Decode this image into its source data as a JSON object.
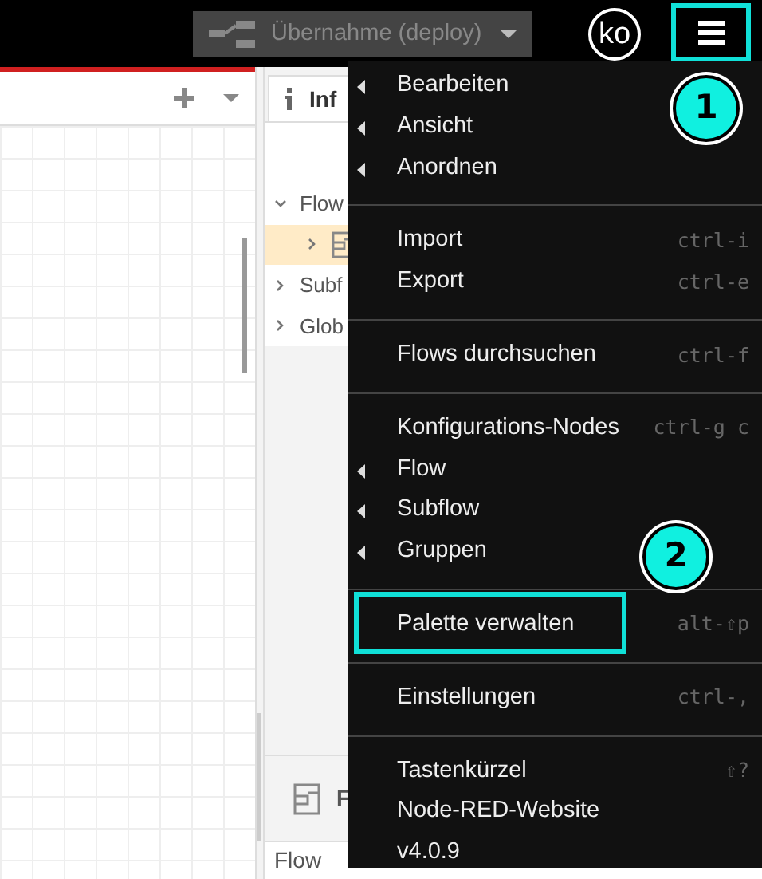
{
  "header": {
    "deploy": {
      "label": "Übernahme (deploy)",
      "disabled": true
    },
    "user": {
      "initials": "ko"
    },
    "menu_button": {
      "highlighted": true
    }
  },
  "sidebar": {
    "tab": {
      "label": "Inf",
      "selected": true
    },
    "tree": [
      {
        "label": "Flow",
        "expanded": true,
        "selected": false,
        "children": [
          {
            "selected": true,
            "expanded": false
          }
        ]
      },
      {
        "label": "Subf",
        "expanded": false,
        "selected": false
      },
      {
        "label": "Glob",
        "expanded": false,
        "selected": false
      }
    ],
    "bottom_panel": {
      "title": "F",
      "row": "Flow"
    }
  },
  "menu": [
    {
      "kind": "item",
      "label": "Bearbeiten",
      "submenu": true
    },
    {
      "kind": "item",
      "label": "Ansicht",
      "submenu": true
    },
    {
      "kind": "item",
      "label": "Anordnen",
      "submenu": true
    },
    {
      "kind": "divider"
    },
    {
      "kind": "item",
      "label": "Import",
      "shortcut": "ctrl-i",
      "submenu": false
    },
    {
      "kind": "item",
      "label": "Export",
      "shortcut": "ctrl-e",
      "submenu": false
    },
    {
      "kind": "divider"
    },
    {
      "kind": "item",
      "label": "Flows durchsuchen",
      "shortcut": "ctrl-f",
      "submenu": false
    },
    {
      "kind": "divider"
    },
    {
      "kind": "item",
      "label": "Konfigurations-Nodes",
      "shortcut": "ctrl-g c",
      "submenu": false
    },
    {
      "kind": "item",
      "label": "Flow",
      "submenu": true
    },
    {
      "kind": "item",
      "label": "Subflow",
      "submenu": true
    },
    {
      "kind": "item",
      "label": "Gruppen",
      "submenu": true
    },
    {
      "kind": "divider"
    },
    {
      "kind": "item",
      "label": "Palette verwalten",
      "shortcut": "alt-⇧p",
      "submenu": false,
      "highlighted": true
    },
    {
      "kind": "divider"
    },
    {
      "kind": "item",
      "label": "Einstellungen",
      "shortcut": "ctrl-,",
      "submenu": false
    },
    {
      "kind": "divider"
    },
    {
      "kind": "item",
      "label": "Tastenkürzel",
      "shortcut": "⇧?",
      "submenu": false
    },
    {
      "kind": "item",
      "label": "Node-RED-Website",
      "submenu": false
    },
    {
      "kind": "item",
      "label": "v4.0.9",
      "submenu": false
    }
  ],
  "callouts": [
    {
      "number": "1"
    },
    {
      "number": "2"
    }
  ]
}
